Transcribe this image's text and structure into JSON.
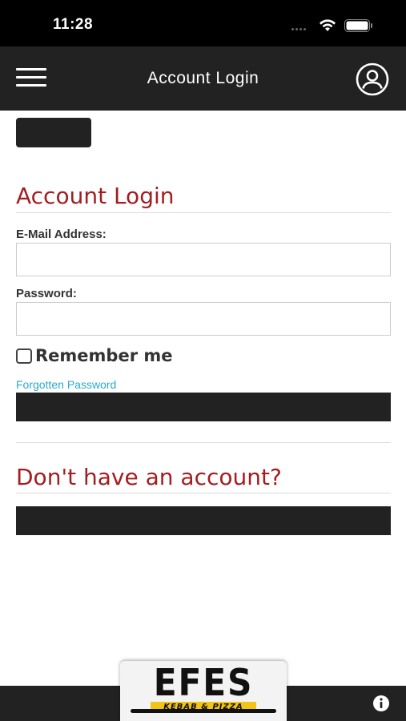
{
  "status_bar": {
    "time": "11:28"
  },
  "header": {
    "title": "Account Login"
  },
  "login_section": {
    "title": "Account Login",
    "email_label": "E-Mail Address:",
    "email_value": "",
    "password_label": "Password:",
    "password_value": "",
    "remember_label": "Remember me",
    "remember_checked": false,
    "forgot_link": "Forgotten Password"
  },
  "register_section": {
    "title": "Don't have an account?"
  },
  "logo": {
    "main_text": "EFES",
    "sub_text": "KEBAB & PIZZA"
  },
  "colors": {
    "header_bg": "#222222",
    "accent_red": "#a31d21",
    "link_blue": "#29aad0",
    "logo_yellow": "#f2c418"
  },
  "icons": {
    "menu": "hamburger-menu-icon",
    "account": "account-circle-icon",
    "info": "info-icon",
    "wifi": "wifi-icon",
    "battery": "battery-icon"
  }
}
